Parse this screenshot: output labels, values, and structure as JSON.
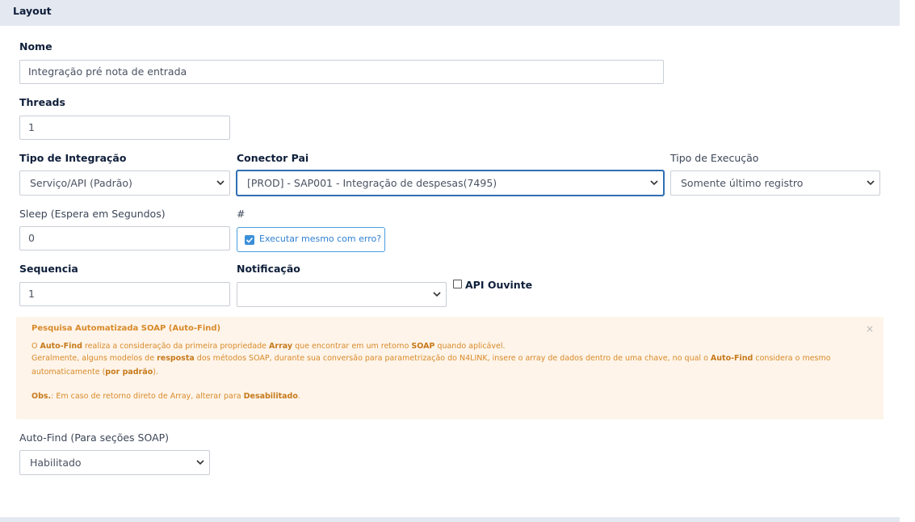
{
  "section": {
    "title": "Layout"
  },
  "fields": {
    "nome": {
      "label": "Nome",
      "value": "Integração pré nota de entrada"
    },
    "threads": {
      "label": "Threads",
      "value": "1"
    },
    "tipo_integracao": {
      "label": "Tipo de Integração",
      "value": "Serviço/API (Padrão)"
    },
    "conector_pai": {
      "label": "Conector Pai",
      "value": "[PROD] - SAP001 - Integração de despesas(7495)"
    },
    "tipo_execucao": {
      "label": "Tipo de Execução",
      "value": "Somente último registro"
    },
    "sleep": {
      "label": "Sleep (Espera em Segundos)",
      "value": "0"
    },
    "hash": {
      "label": "#",
      "checkbox_label": "Executar mesmo com erro?",
      "checked": true
    },
    "sequencia": {
      "label": "Sequencia",
      "value": "1"
    },
    "notificacao": {
      "label": "Notificação",
      "value": ""
    },
    "api_ouvinte": {
      "label": "API Ouvinte",
      "checked": false
    },
    "auto_find": {
      "label": "Auto-Find (Para seções SOAP)",
      "value": "Habilitado"
    }
  },
  "alert": {
    "title": "Pesquisa Automatizada SOAP (Auto-Find)",
    "close": "×",
    "line1": {
      "a": "O ",
      "b": "Auto-Find",
      "c": " realiza a consideração da primeira propriedade ",
      "d": "Array",
      "e": " que encontrar em um retorno ",
      "f": "SOAP",
      "g": " quando aplicável."
    },
    "line2": {
      "a": "Geralmente, alguns modelos de ",
      "b": "resposta",
      "c": " dos métodos SOAP, durante sua conversão para parametrização do N4LINK, insere o array de dados dentro de uma chave, no qual o ",
      "d": "Auto-Find",
      "e": " considera o mesmo"
    },
    "line3": {
      "a": "automaticamente (",
      "b": "por padrão",
      "c": ")."
    },
    "line4": {
      "a": "Obs.",
      "b": ": Em caso de retorno direto de Array, alterar para ",
      "c": "Desabilitado",
      "d": "."
    }
  },
  "colors": {
    "accent": "#2f6fb3",
    "alert_bg": "#fef4e9",
    "alert_text": "#d88a2a",
    "header_bg": "#e4e8f0"
  }
}
